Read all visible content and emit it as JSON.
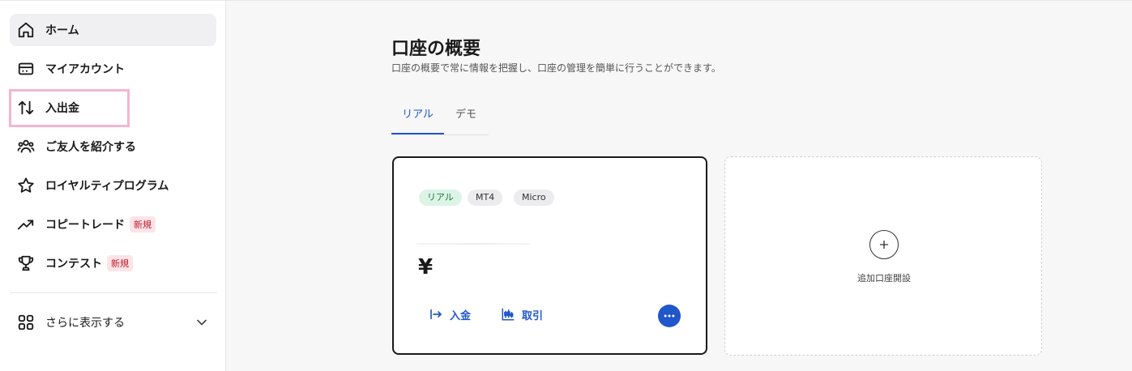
{
  "sidebar": {
    "items": [
      {
        "label": "ホーム",
        "icon": "home-icon"
      },
      {
        "label": "マイアカウント",
        "icon": "wallet-icon"
      },
      {
        "label": "入出金",
        "icon": "transfer-arrows-icon"
      },
      {
        "label": "ご友人を紹介する",
        "icon": "people-icon"
      },
      {
        "label": "ロイヤルティプログラム",
        "icon": "star-icon"
      },
      {
        "label": "コピートレード",
        "icon": "trending-up-icon",
        "badge": "新規"
      },
      {
        "label": "コンテスト",
        "icon": "trophy-icon",
        "badge": "新規"
      }
    ],
    "more_label": "さらに表示する"
  },
  "main": {
    "title": "口座の概要",
    "subtitle": "口座の概要で常に情報を把握し、口座の管理を簡単に行うことができます。",
    "tabs": [
      {
        "label": "リアル",
        "active": true
      },
      {
        "label": "デモ",
        "active": false
      }
    ],
    "account_card": {
      "chips": [
        "リアル",
        "MT4",
        "Micro"
      ],
      "balance": "¥",
      "deposit_label": "入金",
      "trade_label": "取引"
    },
    "add_card": {
      "label": "追加口座開設"
    }
  },
  "colors": {
    "accent": "#1f56c9",
    "badge_new_bg": "#fde4e7",
    "badge_new_text": "#c0182f",
    "chip_real_bg": "#dcf3e6",
    "highlight": "#f2b6cf"
  }
}
